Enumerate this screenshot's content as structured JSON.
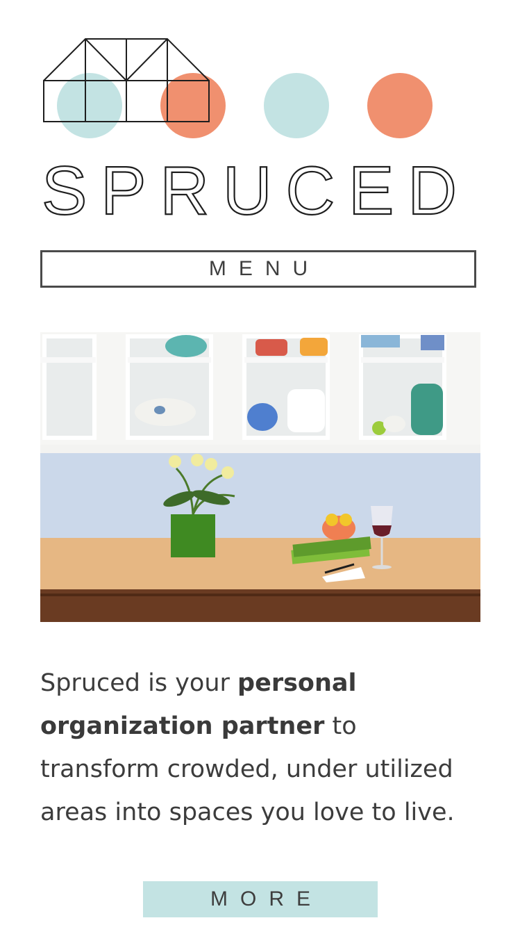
{
  "brand": {
    "name": "SPRUCED",
    "colors": {
      "teal": "#c3e3e3",
      "coral": "#f0906f",
      "ink": "#222222"
    }
  },
  "nav": {
    "menu_label": "MENU"
  },
  "hero": {
    "alt_subject": "kitchen-cabinets-photo"
  },
  "intro": {
    "part1": "Spruced is your ",
    "bold": "personal organization partner",
    "part2": " to transform crowded, under utilized areas into spaces you love to live."
  },
  "cta": {
    "more_label": "MORE"
  }
}
